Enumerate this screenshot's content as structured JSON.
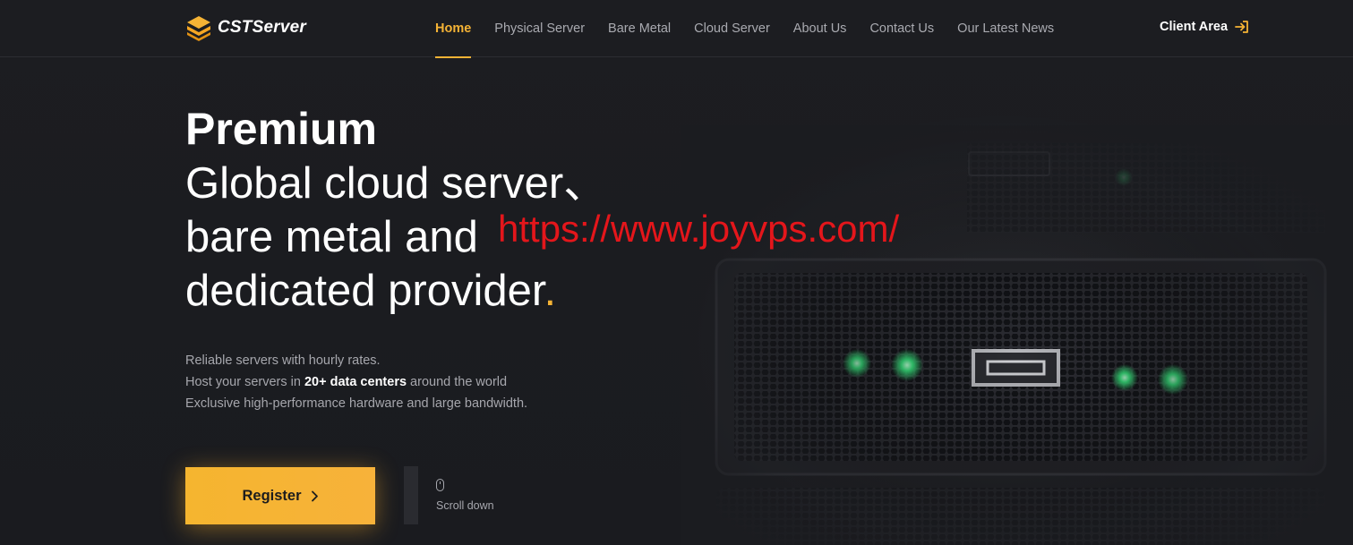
{
  "brand": {
    "name": "CSTServer",
    "accent": "#f5b335"
  },
  "nav": {
    "items": [
      {
        "label": "Home",
        "active": true
      },
      {
        "label": "Physical Server",
        "active": false
      },
      {
        "label": "Bare Metal",
        "active": false
      },
      {
        "label": "Cloud Server",
        "active": false
      },
      {
        "label": "About Us",
        "active": false
      },
      {
        "label": "Contact Us",
        "active": false
      },
      {
        "label": "Our Latest News",
        "active": false
      }
    ],
    "client_area": "Client Area",
    "client_area_icon": "sign-in-icon"
  },
  "hero": {
    "line1": "Premium",
    "line2": "Global cloud server、",
    "line3": "bare metal and",
    "line4": "dedicated provider",
    "line4_dot": ".",
    "watermark": "https://www.joyvps.com/",
    "watermark_color": "#e4161b",
    "desc1": "Reliable servers with hourly rates.",
    "desc2_pre": "Host your servers in ",
    "desc2_bold": "20+ data centers",
    "desc2_post": " around the world",
    "desc3": "Exclusive high-performance hardware and large bandwidth."
  },
  "actions": {
    "register": "Register",
    "register_icon": "chevron-right-icon",
    "scroll_down": "Scroll down",
    "scroll_icon": "mouse-icon"
  }
}
